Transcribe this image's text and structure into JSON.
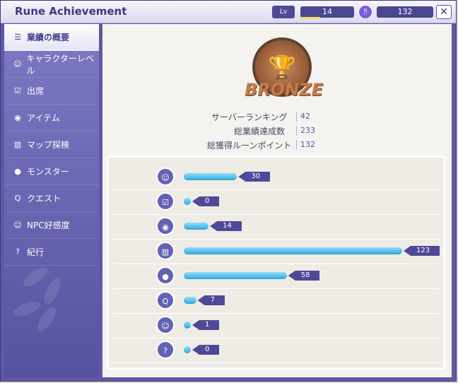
{
  "window": {
    "title": "Rune Achievement",
    "lv_label": "Lv",
    "level": "14",
    "points": "132",
    "close": "✕"
  },
  "sidebar": {
    "items": [
      {
        "label": "業績の概要",
        "icon": "list-icon",
        "glyph": "☰"
      },
      {
        "label": "キャラクターレベル",
        "icon": "character-icon",
        "glyph": "☺"
      },
      {
        "label": "出席",
        "icon": "checkbox-icon",
        "glyph": "☑"
      },
      {
        "label": "アイテム",
        "icon": "bag-icon",
        "glyph": "◉"
      },
      {
        "label": "マップ探検",
        "icon": "map-icon",
        "glyph": "▥"
      },
      {
        "label": "モンスター",
        "icon": "monster-icon",
        "glyph": "●"
      },
      {
        "label": "クエスト",
        "icon": "quest-icon",
        "glyph": "Q"
      },
      {
        "label": "NPC好感度",
        "icon": "npc-smile-icon",
        "glyph": "☺"
      },
      {
        "label": "紀行",
        "icon": "question-icon",
        "glyph": "?"
      }
    ]
  },
  "summary": {
    "badge": "BRONZE",
    "rows": [
      {
        "label": "サーバーランキング",
        "value": "42"
      },
      {
        "label": "総業績達成数",
        "value": "233"
      },
      {
        "label": "総獲得ルーンポイント",
        "value": "132"
      }
    ]
  },
  "chart_data": {
    "type": "bar",
    "orientation": "horizontal",
    "categories": [
      "character",
      "attendance",
      "item",
      "map",
      "monster",
      "quest",
      "npc",
      "journal"
    ],
    "values": [
      30,
      0,
      14,
      123,
      58,
      7,
      1,
      0
    ],
    "xlim": [
      0,
      123
    ],
    "grid": false,
    "colors": {
      "bar": "#33a9df",
      "label": "#4f4997"
    }
  }
}
